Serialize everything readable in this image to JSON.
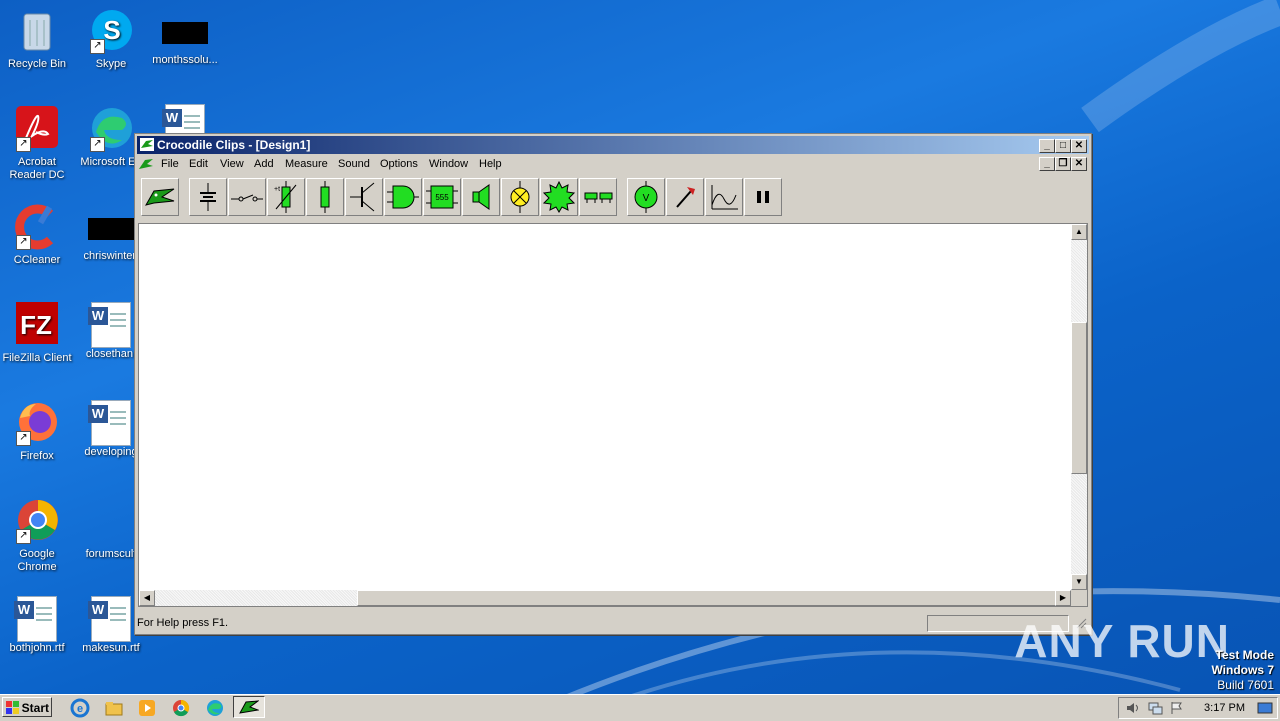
{
  "desktop": {
    "icons": [
      {
        "label": "Recycle Bin",
        "icon": "recycle-bin-icon"
      },
      {
        "label": "Skype",
        "icon": "skype-icon"
      },
      {
        "label": "monthssolu...",
        "icon": "redacted-icon"
      },
      {
        "label": "Acrobat Reader DC",
        "icon": "acrobat-icon"
      },
      {
        "label": "Microsoft Ed",
        "icon": "edge-icon"
      },
      {
        "label": "",
        "icon": "word-doc-icon"
      },
      {
        "label": "CCleaner",
        "icon": "ccleaner-icon"
      },
      {
        "label": "chriswinter.",
        "icon": "redacted-icon"
      },
      {
        "label": "FileZilla Client",
        "icon": "filezilla-icon"
      },
      {
        "label": "closethan.",
        "icon": "word-doc-icon"
      },
      {
        "label": "Firefox",
        "icon": "firefox-icon"
      },
      {
        "label": "developing",
        "icon": "word-doc-icon"
      },
      {
        "label": "Google Chrome",
        "icon": "chrome-icon"
      },
      {
        "label": "forumscult",
        "icon": "blank-icon"
      },
      {
        "label": "bothjohn.rtf",
        "icon": "word-doc-icon"
      },
      {
        "label": "makesun.rtf",
        "icon": "word-doc-icon"
      }
    ]
  },
  "window": {
    "title": "Crocodile Clips - [Design1]",
    "menu": [
      "File",
      "Edit",
      "View",
      "Add",
      "Measure",
      "Sound",
      "Options",
      "Window",
      "Help"
    ],
    "toolbar": [
      "crocodile-logo-icon",
      "battery-icon",
      "switch-icon",
      "variable-resistor-icon",
      "resistor-icon",
      "transistor-icon",
      "and-gate-icon",
      "chip-555-icon",
      "speaker-icon",
      "lamp-icon",
      "gear-motor-icon",
      "connector-icon",
      "voltmeter-icon",
      "probe-icon",
      "graph-icon",
      "pause-icon"
    ],
    "chip_label": "555",
    "meter_label": "V",
    "status_text": "For Help press F1."
  },
  "watermark": {
    "text": "ANY RUN"
  },
  "test_mode": {
    "line1": "Test Mode",
    "line2": "Windows 7",
    "line3": "Build 7601"
  },
  "taskbar": {
    "start_label": "Start",
    "apps": [
      "ie-icon",
      "explorer-icon",
      "media-player-icon",
      "chrome-icon",
      "edge-icon",
      "crocodile-clips-icon"
    ],
    "clock": "3:17 PM"
  },
  "colors": {
    "desktop": "#0d5fc4",
    "title_start": "#0a246a",
    "title_end": "#a6caf0",
    "tool_green": "#22dd22"
  }
}
